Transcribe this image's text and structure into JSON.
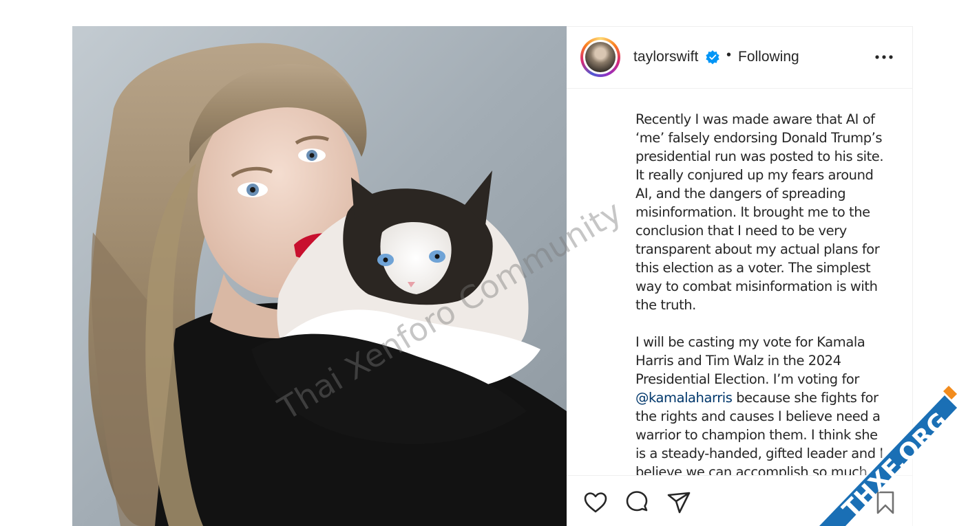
{
  "post": {
    "username": "taylorswift",
    "separator": "•",
    "follow_status": "Following",
    "caption_paragraphs": [
      "Recently I was made aware that AI of\n‘me’ falsely endorsing Donald Trump’s\npresidential run was posted to his site.\nIt really conjured up my fears around\nAI, and the dangers of spreading\nmisinformation. It brought me to the\nconclusion that I need to be very\ntransparent about my actual plans for\nthis election as a voter. The simplest\nway to combat misinformation is with\nthe truth."
    ],
    "caption_p2_before": "I will be casting my vote for Kamala\nHarris and Tim Walz in the 2024\nPresidential Election. I’m voting for\n",
    "caption_mention": "@kamalaharris",
    "caption_p2_after": " because she fights for\nthe rights and causes I believe need a\nwarrior to champion them. I think she\nis a steady-handed, gifted leader and I\nbelieve we can accomplish so much"
  },
  "overlays": {
    "watermark_text": "Thai Xenforo Community",
    "badge_text": "THXF.ORG",
    "badge_color": "#1a6fb5",
    "badge_accent": "#f28c1e"
  },
  "icons": {
    "verified": "verified-badge-icon",
    "more": "more-options-icon",
    "like": "heart-icon",
    "comment": "comment-icon",
    "share": "paper-plane-icon",
    "save": "bookmark-icon"
  },
  "colors": {
    "text": "#262626",
    "mention": "#00376b",
    "verified_blue": "#0095f6",
    "lipstick": "#c8102e"
  }
}
